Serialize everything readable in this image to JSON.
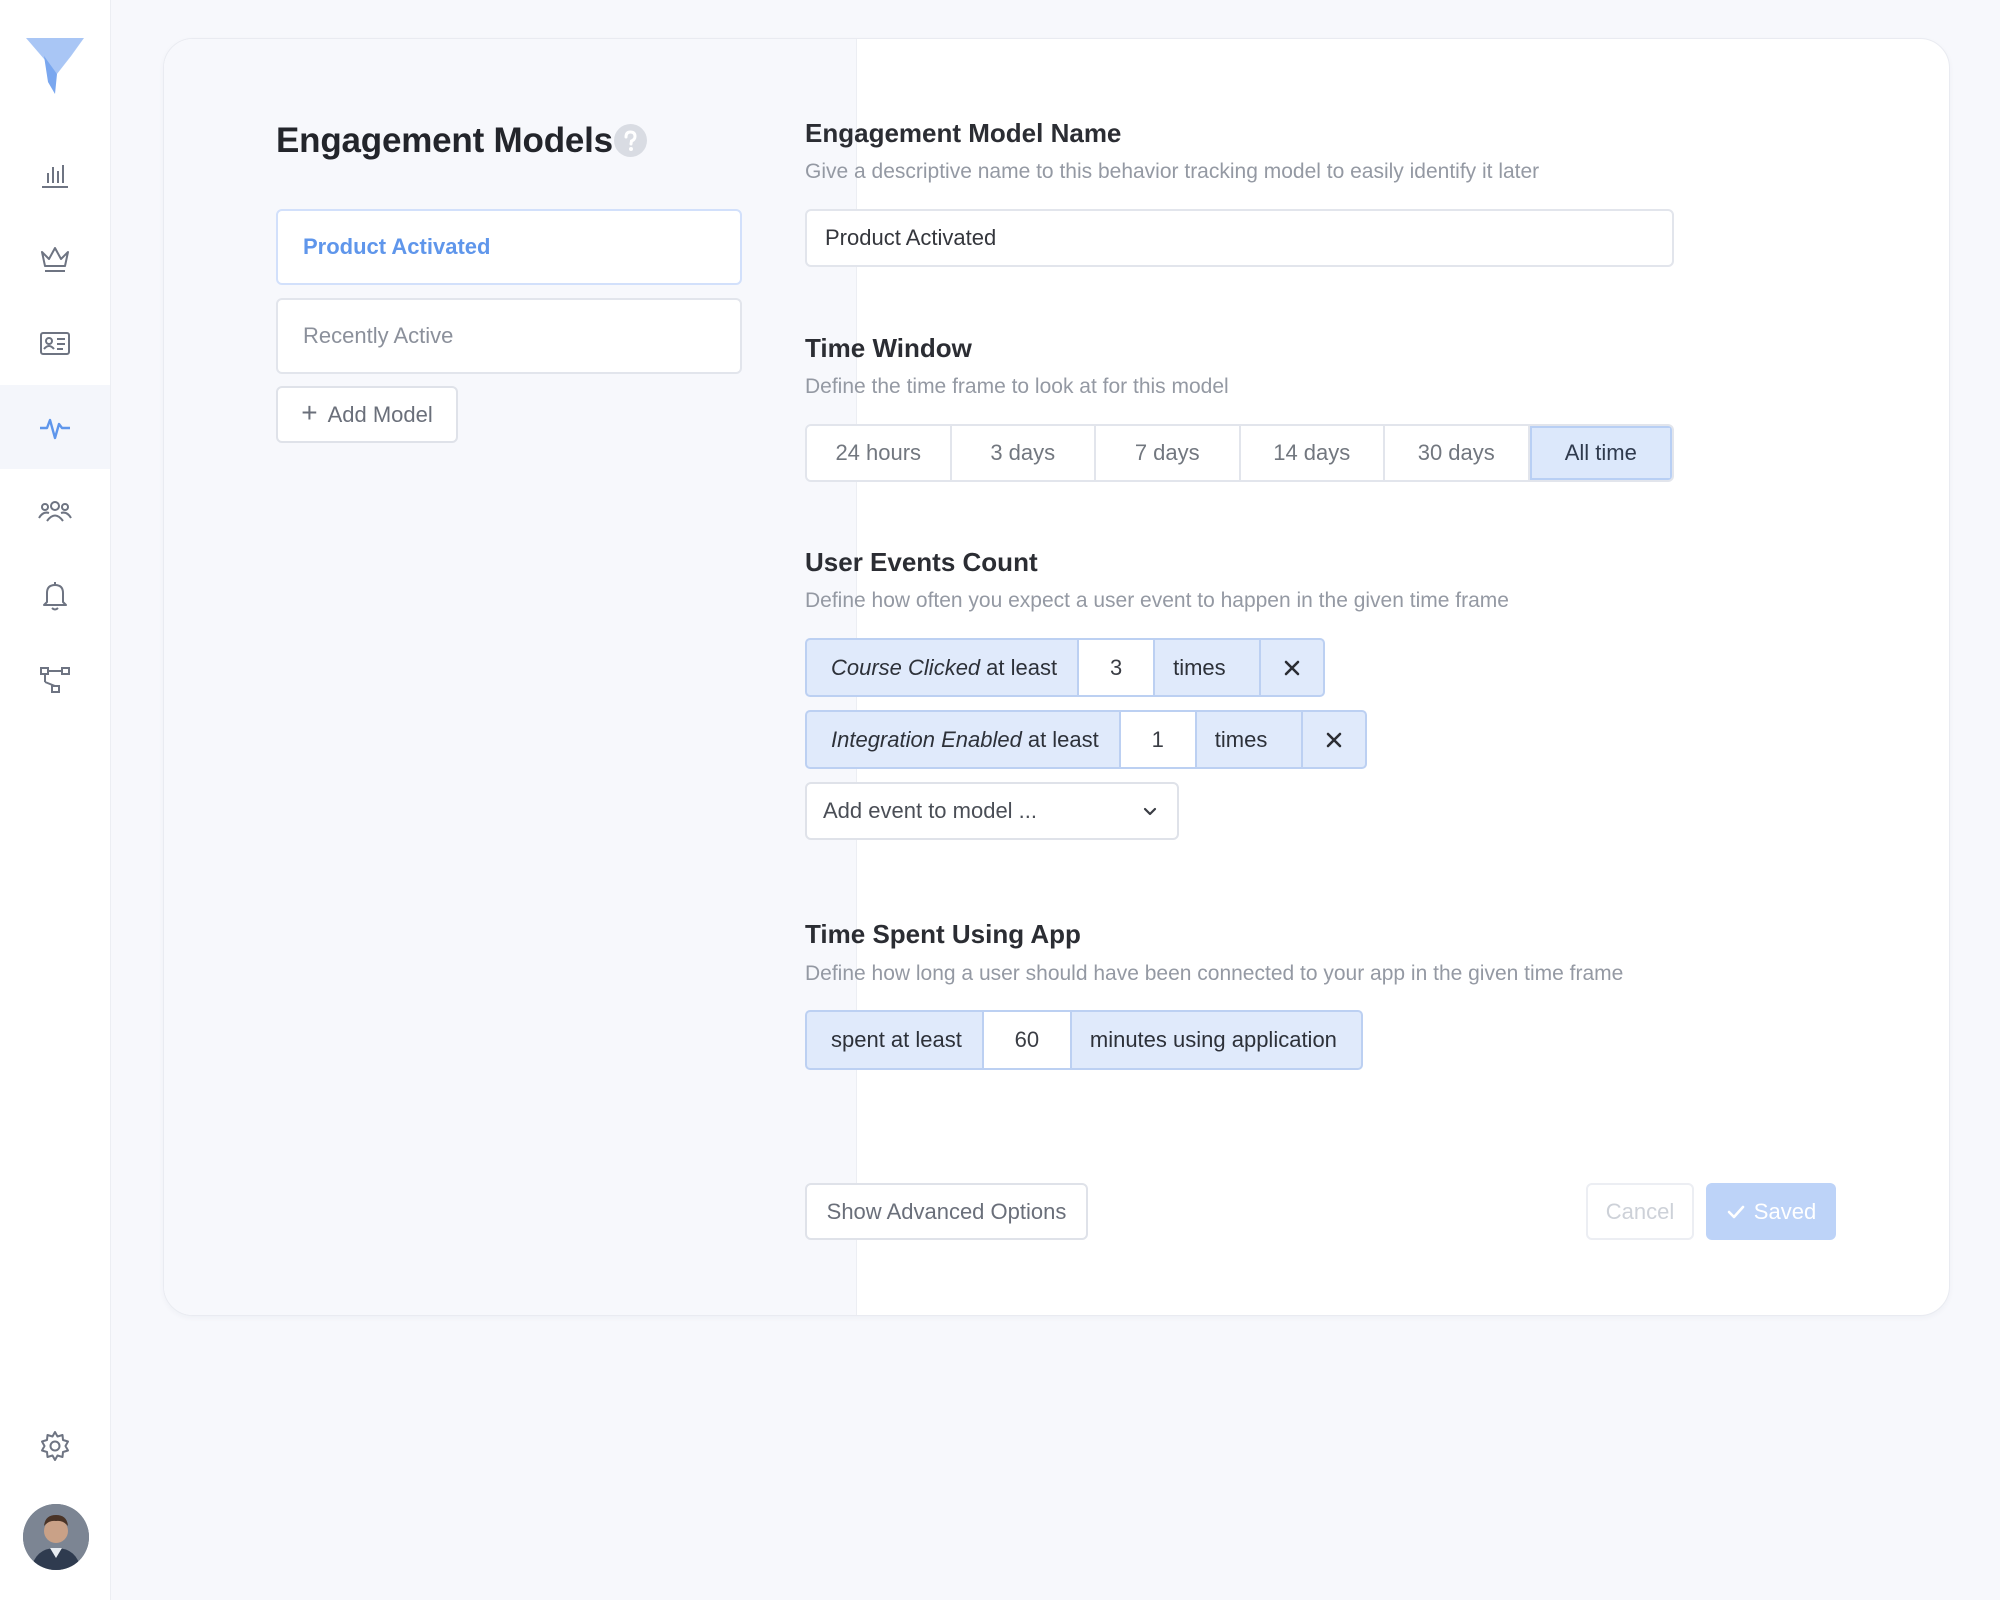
{
  "colors": {
    "accent": "#5f96eb",
    "selected_bg": "#dce8fb",
    "background": "#f7f8fc"
  },
  "sidebar": {
    "items": [
      {
        "icon": "bar-chart-icon"
      },
      {
        "icon": "crown-icon"
      },
      {
        "icon": "contact-card-icon"
      },
      {
        "icon": "activity-pulse-icon",
        "active": true
      },
      {
        "icon": "users-icon"
      },
      {
        "icon": "bell-icon"
      },
      {
        "icon": "flow-hierarchy-icon"
      }
    ],
    "settings_icon": "gear-icon",
    "avatar": "user-avatar"
  },
  "models": {
    "title": "Engagement Models",
    "items": [
      {
        "label": "Product Activated",
        "active": true
      },
      {
        "label": "Recently Active",
        "active": false
      }
    ],
    "add_label": "Add Model"
  },
  "model_name": {
    "title": "Engagement Model Name",
    "description": "Give a descriptive name to this behavior tracking model to easily identify it later",
    "value": "Product Activated"
  },
  "time_window": {
    "title": "Time Window",
    "description": "Define the time frame to look at for this model",
    "options": [
      "24 hours",
      "3 days",
      "7 days",
      "14 days",
      "30 days",
      "All time"
    ],
    "selected": "All time"
  },
  "events_count": {
    "title": "User Events Count",
    "description": "Define how often you expect a user event to happen in the given time frame",
    "events": [
      {
        "name": "Course Clicked",
        "qualifier": "at least",
        "count": "3",
        "unit": "times"
      },
      {
        "name": "Integration Enabled",
        "qualifier": "at least",
        "count": "1",
        "unit": "times"
      }
    ],
    "add_placeholder": "Add event to model ..."
  },
  "time_spent": {
    "title": "Time Spent Using App",
    "description": "Define how long a user should have been connected to your app in the given time frame",
    "prefix": "spent at least",
    "value": "60",
    "suffix": "minutes using application"
  },
  "actions": {
    "advanced": "Show Advanced Options",
    "cancel": "Cancel",
    "saved": "Saved"
  }
}
